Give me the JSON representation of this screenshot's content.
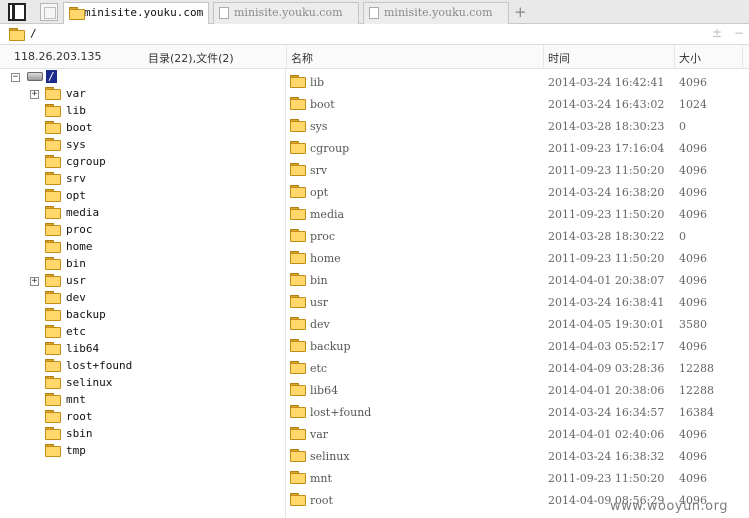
{
  "tabs": [
    {
      "label": "minisite.youku.com",
      "active": true
    },
    {
      "label": "minisite.youku.com",
      "active": false
    },
    {
      "label": "minisite.youku.com",
      "active": false
    }
  ],
  "tab_add": "+",
  "address": {
    "path": "/",
    "ctl_plus": "±",
    "ctl_minus": "−"
  },
  "header": {
    "ip": "118.26.203.135",
    "count": "目录(22),文件(2)",
    "col_name": "名称",
    "col_time": "时间",
    "col_size": "大小"
  },
  "tree": {
    "root": "/",
    "nodes": [
      {
        "name": "var",
        "expander": "+"
      },
      {
        "name": "lib"
      },
      {
        "name": "boot"
      },
      {
        "name": "sys"
      },
      {
        "name": "cgroup"
      },
      {
        "name": "srv"
      },
      {
        "name": "opt"
      },
      {
        "name": "media"
      },
      {
        "name": "proc"
      },
      {
        "name": "home"
      },
      {
        "name": "bin"
      },
      {
        "name": "usr",
        "expander": "+"
      },
      {
        "name": "dev"
      },
      {
        "name": "backup"
      },
      {
        "name": "etc"
      },
      {
        "name": "lib64"
      },
      {
        "name": "lost+found"
      },
      {
        "name": "selinux"
      },
      {
        "name": "mnt"
      },
      {
        "name": "root"
      },
      {
        "name": "sbin"
      },
      {
        "name": "tmp"
      }
    ]
  },
  "files": [
    {
      "name": "lib",
      "time": "2014-03-24 16:42:41",
      "size": "4096"
    },
    {
      "name": "boot",
      "time": "2014-03-24 16:43:02",
      "size": "1024"
    },
    {
      "name": "sys",
      "time": "2014-03-28 18:30:23",
      "size": "0"
    },
    {
      "name": "cgroup",
      "time": "2011-09-23 17:16:04",
      "size": "4096"
    },
    {
      "name": "srv",
      "time": "2011-09-23 11:50:20",
      "size": "4096"
    },
    {
      "name": "opt",
      "time": "2014-03-24 16:38:20",
      "size": "4096"
    },
    {
      "name": "media",
      "time": "2011-09-23 11:50:20",
      "size": "4096"
    },
    {
      "name": "proc",
      "time": "2014-03-28 18:30:22",
      "size": "0"
    },
    {
      "name": "home",
      "time": "2011-09-23 11:50:20",
      "size": "4096"
    },
    {
      "name": "bin",
      "time": "2014-04-01 20:38:07",
      "size": "4096"
    },
    {
      "name": "usr",
      "time": "2014-03-24 16:38:41",
      "size": "4096"
    },
    {
      "name": "dev",
      "time": "2014-04-05 19:30:01",
      "size": "3580"
    },
    {
      "name": "backup",
      "time": "2014-04-03 05:52:17",
      "size": "4096"
    },
    {
      "name": "etc",
      "time": "2014-04-09 03:28:36",
      "size": "12288"
    },
    {
      "name": "lib64",
      "time": "2014-04-01 20:38:06",
      "size": "12288"
    },
    {
      "name": "lost+found",
      "time": "2014-03-24 16:34:57",
      "size": "16384"
    },
    {
      "name": "var",
      "time": "2014-04-01 02:40:06",
      "size": "4096"
    },
    {
      "name": "selinux",
      "time": "2014-03-24 16:38:32",
      "size": "4096"
    },
    {
      "name": "mnt",
      "time": "2011-09-23 11:50:20",
      "size": "4096"
    },
    {
      "name": "root",
      "time": "2014-04-09 08:56:29",
      "size": "4096"
    }
  ],
  "watermark": "www.wooyun.org",
  "colors": {
    "folder": "#ffd76a",
    "selection": "#1a2b8c"
  }
}
